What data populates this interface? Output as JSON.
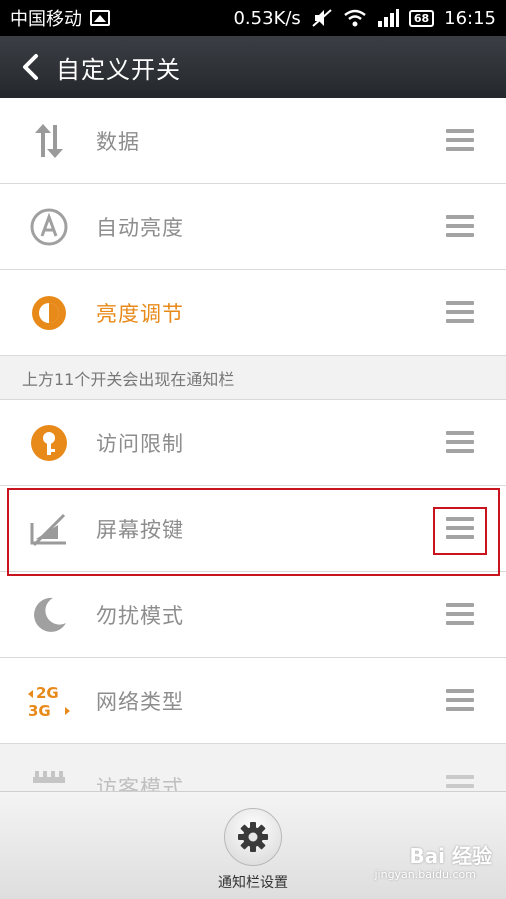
{
  "status_bar": {
    "carrier": "中国移动",
    "speed": "0.53K/s",
    "battery": "68",
    "time": "16:15"
  },
  "header": {
    "title": "自定义开关"
  },
  "list_top": [
    {
      "label": "数据",
      "icon": "data-sync-icon",
      "color": "gray"
    },
    {
      "label": "自动亮度",
      "icon": "auto-brightness-icon",
      "color": "gray"
    },
    {
      "label": "亮度调节",
      "icon": "brightness-icon",
      "color": "orange"
    }
  ],
  "section_note": "上方11个开关会出现在通知栏",
  "list_bottom": [
    {
      "label": "访问限制",
      "icon": "key-icon",
      "color": "gray"
    },
    {
      "label": "屏幕按键",
      "icon": "screen-buttons-icon",
      "color": "gray"
    },
    {
      "label": "勿扰模式",
      "icon": "moon-icon",
      "color": "gray"
    },
    {
      "label": "网络类型",
      "icon": "network-type-icon",
      "color": "gray"
    },
    {
      "label": "访客模式",
      "icon": "guest-mode-icon",
      "color": "gray"
    }
  ],
  "bottom_bar": {
    "label": "通知栏设置"
  },
  "watermark": {
    "brand": "Bai 经验",
    "url": "jingyan.baidu.com"
  },
  "colors": {
    "accent": "#e88a1a",
    "highlight": "#c8141e",
    "text_gray": "#8d8d8d"
  }
}
